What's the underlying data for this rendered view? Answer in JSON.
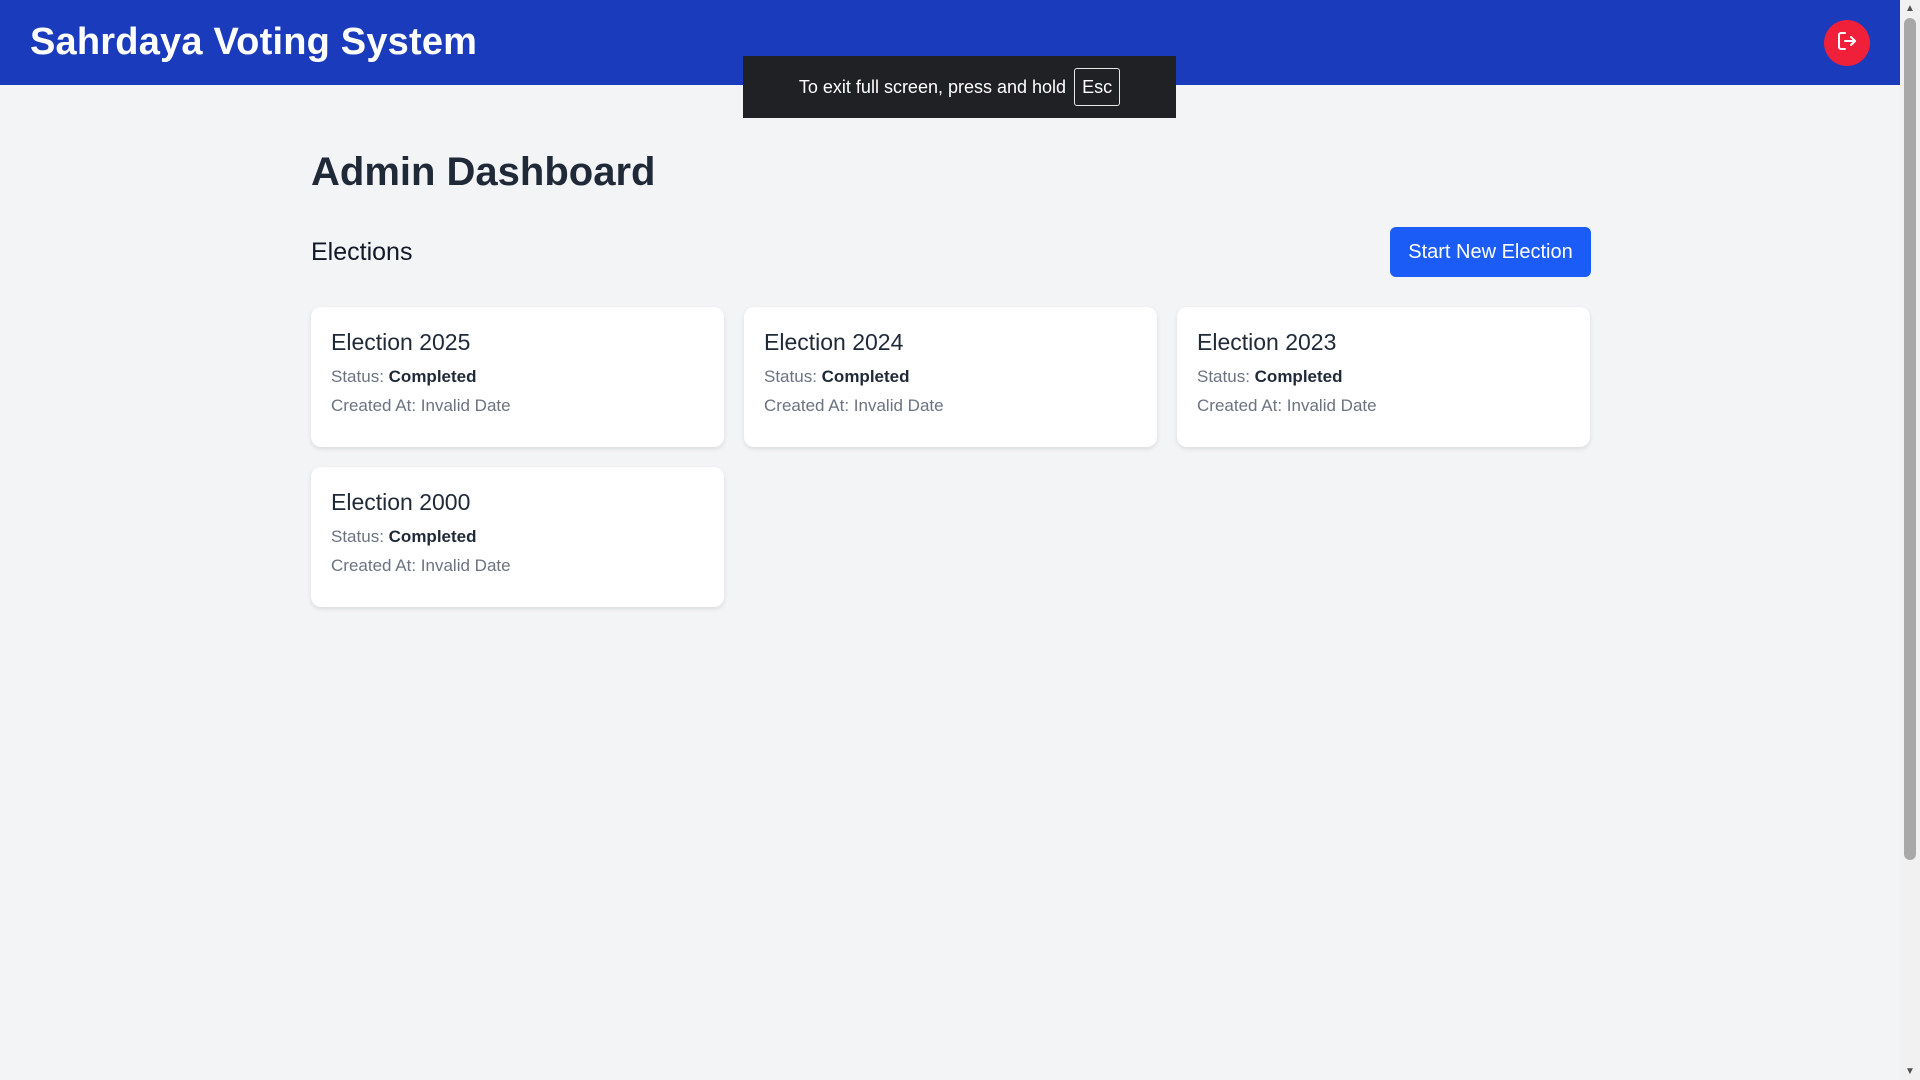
{
  "app": {
    "title": "Sahrdaya Voting System"
  },
  "header": {
    "logout_icon": "logout-icon",
    "logout_color": "#f0203a"
  },
  "fullscreen_toast": {
    "text": "To exit full screen, press and hold",
    "key": "Esc"
  },
  "page": {
    "title": "Admin Dashboard",
    "section_title": "Elections",
    "start_button_label": "Start New Election"
  },
  "status_label": "Status:",
  "created_label": "Created At:",
  "elections": [
    {
      "name": "Election 2025",
      "status": "Completed",
      "created_at": "Invalid Date"
    },
    {
      "name": "Election 2024",
      "status": "Completed",
      "created_at": "Invalid Date"
    },
    {
      "name": "Election 2023",
      "status": "Completed",
      "created_at": "Invalid Date"
    },
    {
      "name": "Election 2000",
      "status": "Completed",
      "created_at": "Invalid Date"
    }
  ],
  "colors": {
    "header_bg": "#1b3bbd",
    "primary_button": "#1a5cf5",
    "page_bg": "#f3f4f6"
  }
}
